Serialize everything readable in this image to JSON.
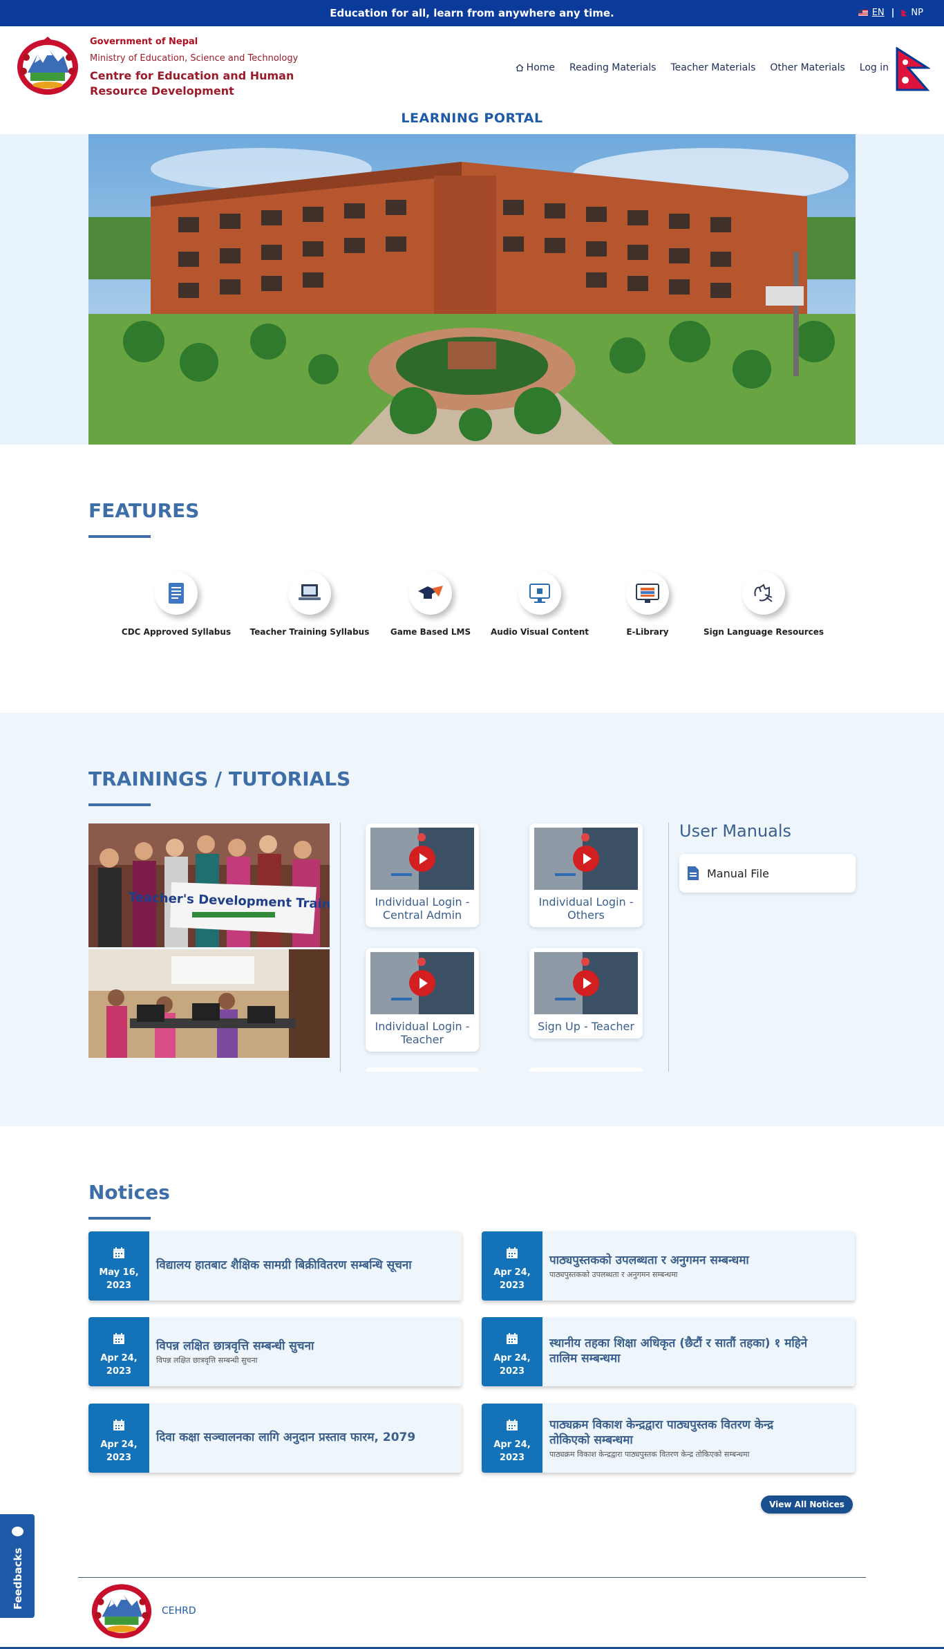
{
  "topbar": {
    "slogan": "Education for all, learn from anywhere any time.",
    "lang_en": "EN",
    "separator": "|",
    "lang_np": "NP"
  },
  "header": {
    "gov": "Government of Nepal",
    "ministry": "Ministry of Education, Science and Technology",
    "centre": "Centre for Education and Human Resource Development"
  },
  "nav": {
    "home": "Home",
    "reading": "Reading Materials",
    "teacher": "Teacher Materials",
    "other": "Other Materials",
    "login": "Log in"
  },
  "portal_title": "LEARNING PORTAL",
  "features": {
    "title": "FEATURES",
    "items": [
      {
        "label": "CDC Approved Syllabus",
        "icon": "syllabus-icon"
      },
      {
        "label": "Teacher Training Syllabus",
        "icon": "laptop-icon"
      },
      {
        "label": "Game Based LMS",
        "icon": "graduation-cap-icon"
      },
      {
        "label": "Audio Visual Content",
        "icon": "monitor-icon"
      },
      {
        "label": "E-Library",
        "icon": "books-icon"
      },
      {
        "label": "Sign Language Resources",
        "icon": "sign-language-icon"
      }
    ]
  },
  "trainings": {
    "title": "TRAININGS / TUTORIALS",
    "banner_text": "Teacher's Development Training",
    "videos": [
      {
        "title": "Individual Login - Central Admin"
      },
      {
        "title": "Individual Login - Others"
      },
      {
        "title": "Individual Login - Teacher"
      },
      {
        "title": "Sign Up - Teacher"
      }
    ],
    "manuals_title": "User Manuals",
    "manual_file": "Manual File"
  },
  "notices": {
    "title": "Notices",
    "items": [
      {
        "date": "May 16, 2023",
        "title": "विद्यालय हातबाट शैक्षिक सामग्री बिक्रीवितरण सम्बन्धि सूचना",
        "sub": ""
      },
      {
        "date": "Apr 24, 2023",
        "title": "पाठ्यपुस्तकको उपलब्धता र अनुगमन सम्बन्धमा",
        "sub": "पाठ्यपुस्तकको उपलब्धता र अनुगमन सम्बन्धमा"
      },
      {
        "date": "Apr 24, 2023",
        "title": "विपन्न लक्षित छात्रवृत्ति सम्बन्धी सुचना",
        "sub": "विपन्न लक्षित छात्रवृत्ति सम्बन्धी सुचना"
      },
      {
        "date": "Apr 24, 2023",
        "title": "स्थानीय तहका शिक्षा अधिकृत (छैटौं र सातौं तहका) १ महिने तालिम सम्बन्धमा",
        "sub": ""
      },
      {
        "date": "Apr 24, 2023",
        "title": "दिवा कक्षा सञ्चालनका लागि अनुदान प्रस्ताव फारम, 2079",
        "sub": ""
      },
      {
        "date": "Apr 24, 2023",
        "title": "पाठ्यक्रम विकाश केन्द्रद्वारा पाठ्यपुस्तक वितरण केन्द्र तोकिएको सम्बन्धमा",
        "sub": "पाठ्यक्रम विकाश केन्द्रद्वारा पाठ्यपुस्तक वितरण केन्द्र तोकिएको सम्बन्धमा"
      }
    ],
    "view_all": "View All Notices"
  },
  "feedback": "Feedbacks",
  "footer": {
    "name": "CEHRD"
  },
  "colors": {
    "primary": "#0a3a9a",
    "heading": "#3e6ea8",
    "notice_date": "#1473b8",
    "brand_red": "#9b1b2a"
  }
}
